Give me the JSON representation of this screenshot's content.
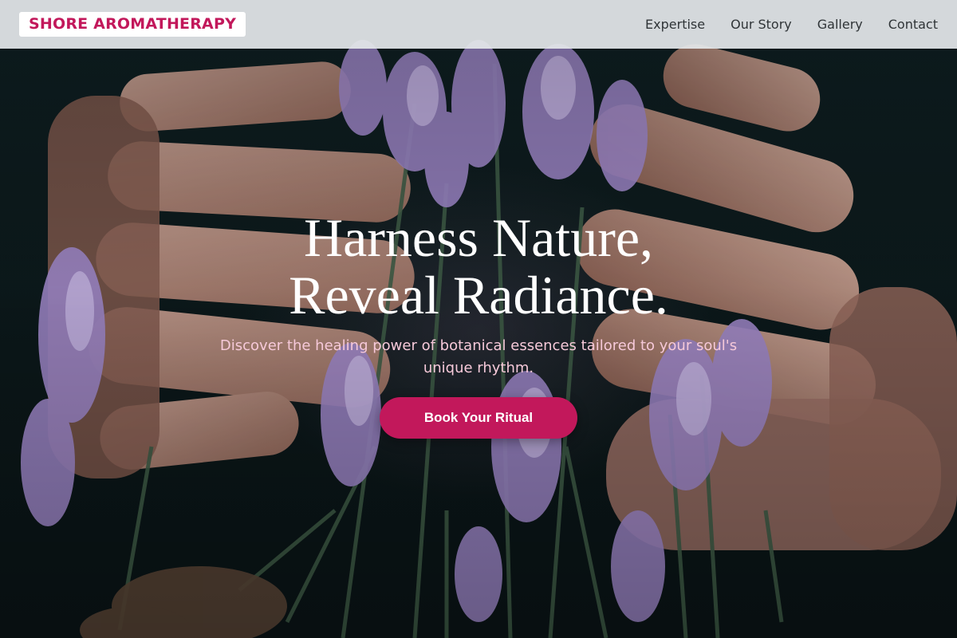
{
  "brand": {
    "name": "SHORE AROMATHERAPY"
  },
  "nav": {
    "items": [
      {
        "label": "Expertise"
      },
      {
        "label": "Our Story"
      },
      {
        "label": "Gallery"
      },
      {
        "label": "Contact"
      }
    ]
  },
  "hero": {
    "title_line1": "Harness Nature,",
    "title_line2": "Reveal Radiance.",
    "subtitle": "Discover the healing power of botanical essences tailored to your soul's unique rhythm.",
    "cta_label": "Book Your Ritual",
    "background_image": "hands holding lavender"
  },
  "colors": {
    "accent": "#c2185b",
    "navbar_bg": "#e4e7e9",
    "subtitle": "#f6c9d9"
  }
}
